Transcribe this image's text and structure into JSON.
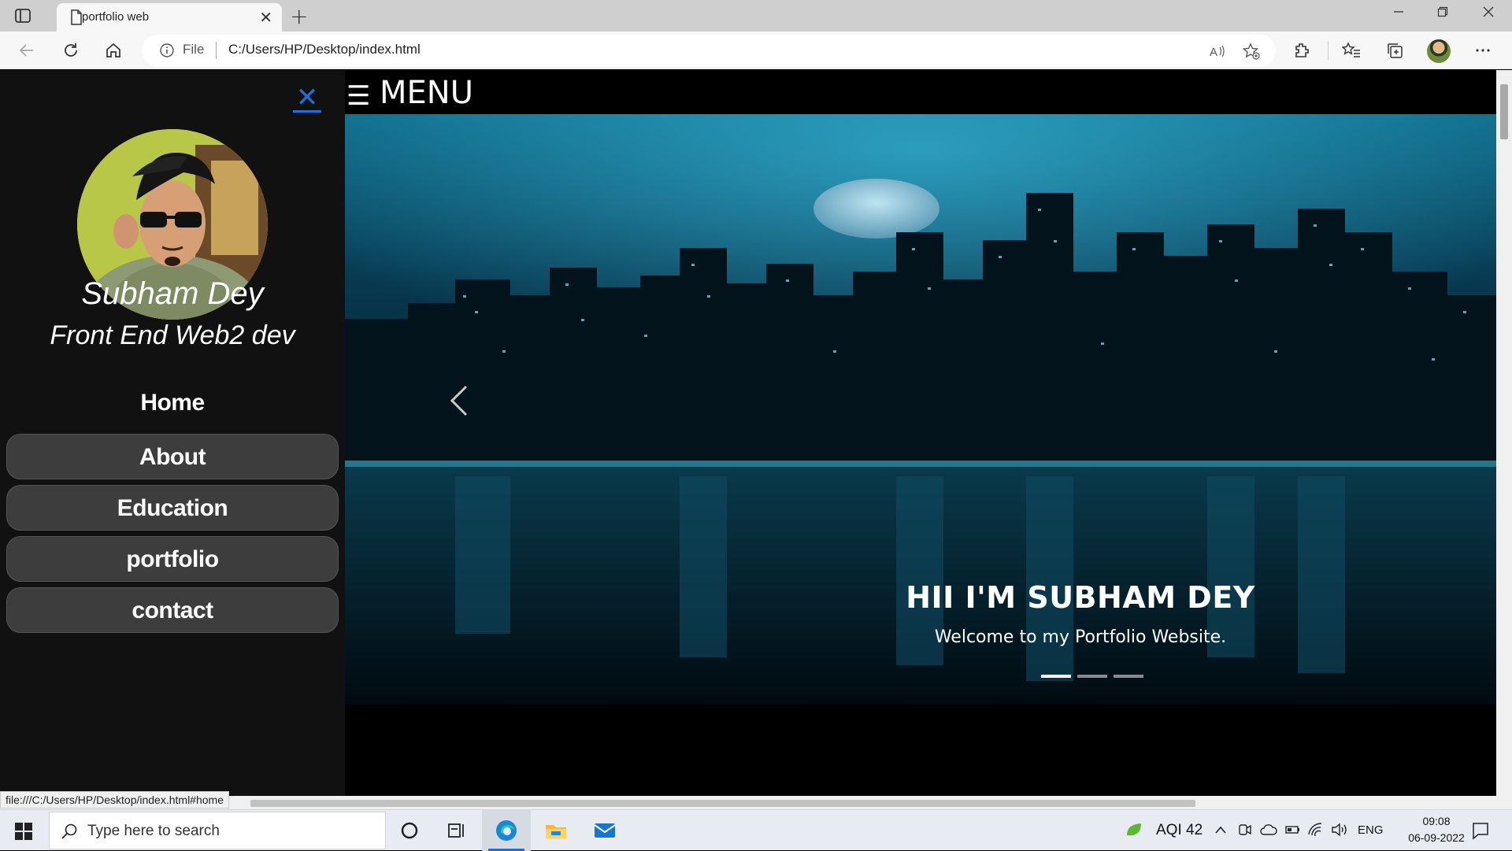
{
  "browser": {
    "tab_title": "portfolio web",
    "tab_close": "✕",
    "new_tab": "+",
    "address_scheme": "File",
    "address_url": "C:/Users/HP/Desktop/index.html",
    "status_url": "file:///C:/Users/HP/Desktop/index.html#home"
  },
  "sidebar": {
    "close_symbol": "✕",
    "name": "Subham Dey",
    "role": "Front End Web2 dev",
    "items": [
      {
        "label": "Home"
      },
      {
        "label": "About"
      },
      {
        "label": "Education"
      },
      {
        "label": "portfolio"
      },
      {
        "label": "contact"
      }
    ]
  },
  "header": {
    "menu_icon": "☰",
    "menu_label": "MENU"
  },
  "hero": {
    "title": "HII I'M SUBHAM DEY",
    "subtitle": "Welcome to my Portfolio Website.",
    "slide_count": 3,
    "active_slide": 1
  },
  "taskbar": {
    "search_placeholder": "Type here to search",
    "aqi": "AQI 42",
    "language": "ENG",
    "time": "09:08",
    "date": "06-09-2022"
  },
  "colors": {
    "accent_blue": "#1e6fd9",
    "sidebar_bg": "#111111",
    "nav_pill": "#3d3d3d"
  }
}
